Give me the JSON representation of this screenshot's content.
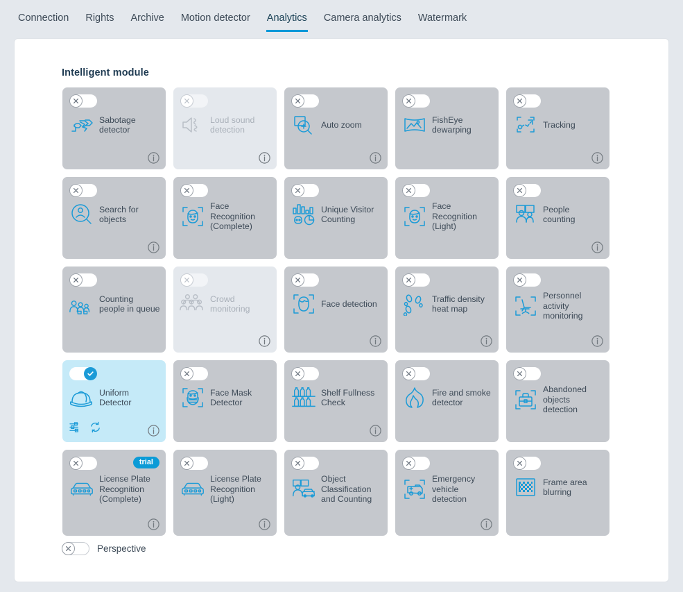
{
  "tabs": [
    {
      "label": "Connection",
      "active": false
    },
    {
      "label": "Rights",
      "active": false
    },
    {
      "label": "Archive",
      "active": false
    },
    {
      "label": "Motion detector",
      "active": false
    },
    {
      "label": "Analytics",
      "active": true
    },
    {
      "label": "Camera analytics",
      "active": false
    },
    {
      "label": "Watermark",
      "active": false
    }
  ],
  "panel": {
    "title": "Intelligent module"
  },
  "colors": {
    "page_background": "#e4e8ed",
    "panel_background": "#ffffff",
    "card_background": "#c5c8cd",
    "card_disabled_background": "#e4e8ed",
    "card_active_background": "#c5eaf8",
    "accent": "#0098d8",
    "toggle_on": "#1b9bd7",
    "trial_badge": "#0b9bd7",
    "text": "#3d4a57",
    "text_disabled": "#a9b0b9"
  },
  "modules": [
    {
      "label": "Sabotage detector",
      "icon": "sabotage-detector-icon",
      "toggle": "off",
      "state": "normal",
      "info": true,
      "badge": null,
      "actions": []
    },
    {
      "label": "Loud sound detection",
      "icon": "loud-sound-detection-icon",
      "toggle": "off",
      "state": "disabled",
      "info": true,
      "badge": null,
      "actions": []
    },
    {
      "label": "Auto zoom",
      "icon": "auto-zoom-icon",
      "toggle": "off",
      "state": "normal",
      "info": true,
      "badge": null,
      "actions": []
    },
    {
      "label": "FishEye dewarping",
      "icon": "fisheye-dewarping-icon",
      "toggle": "off",
      "state": "normal",
      "info": false,
      "badge": null,
      "actions": []
    },
    {
      "label": "Tracking",
      "icon": "tracking-icon",
      "toggle": "off",
      "state": "normal",
      "info": true,
      "badge": null,
      "actions": []
    },
    {
      "label": "Search for objects",
      "icon": "search-for-objects-icon",
      "toggle": "off",
      "state": "normal",
      "info": true,
      "badge": null,
      "actions": []
    },
    {
      "label": "Face Recognition (Complete)",
      "icon": "face-recognition-complete-icon",
      "toggle": "off",
      "state": "normal",
      "info": false,
      "badge": null,
      "actions": []
    },
    {
      "label": "Unique Visitor Counting",
      "icon": "unique-visitor-counting-icon",
      "toggle": "off",
      "state": "normal",
      "info": false,
      "badge": null,
      "actions": []
    },
    {
      "label": "Face Recognition (Light)",
      "icon": "face-recognition-light-icon",
      "toggle": "off",
      "state": "normal",
      "info": false,
      "badge": null,
      "actions": []
    },
    {
      "label": "People counting",
      "icon": "people-counting-icon",
      "toggle": "off",
      "state": "normal",
      "info": true,
      "badge": null,
      "actions": []
    },
    {
      "label": "Counting people in queue",
      "icon": "counting-people-in-queue-icon",
      "toggle": "off",
      "state": "normal",
      "info": false,
      "badge": null,
      "actions": []
    },
    {
      "label": "Crowd monitoring",
      "icon": "crowd-monitoring-icon",
      "toggle": "off",
      "state": "disabled",
      "info": true,
      "badge": null,
      "actions": []
    },
    {
      "label": "Face detection",
      "icon": "face-detection-icon",
      "toggle": "off",
      "state": "normal",
      "info": true,
      "badge": null,
      "actions": []
    },
    {
      "label": "Traffic density heat map",
      "icon": "traffic-density-heat-map-icon",
      "toggle": "off",
      "state": "normal",
      "info": true,
      "badge": null,
      "actions": []
    },
    {
      "label": "Personnel activity monitoring",
      "icon": "personnel-activity-monitoring-icon",
      "toggle": "off",
      "state": "normal",
      "info": true,
      "badge": null,
      "actions": []
    },
    {
      "label": "Uniform Detector",
      "icon": "uniform-detector-icon",
      "toggle": "on",
      "state": "active",
      "info": true,
      "badge": null,
      "actions": [
        "settings-icon",
        "refresh-icon"
      ]
    },
    {
      "label": "Face Mask Detector",
      "icon": "face-mask-detector-icon",
      "toggle": "off",
      "state": "normal",
      "info": false,
      "badge": null,
      "actions": []
    },
    {
      "label": "Shelf Fullness Check",
      "icon": "shelf-fullness-check-icon",
      "toggle": "off",
      "state": "normal",
      "info": true,
      "badge": null,
      "actions": []
    },
    {
      "label": "Fire and smoke detector",
      "icon": "fire-and-smoke-detector-icon",
      "toggle": "off",
      "state": "normal",
      "info": false,
      "badge": null,
      "actions": []
    },
    {
      "label": "Abandoned objects detection",
      "icon": "abandoned-objects-detection-icon",
      "toggle": "off",
      "state": "normal",
      "info": false,
      "badge": null,
      "actions": []
    },
    {
      "label": "License Plate Recognition (Complete)",
      "icon": "license-plate-recognition-icon",
      "toggle": "off",
      "state": "normal",
      "info": true,
      "badge": "trial",
      "actions": []
    },
    {
      "label": "License Plate Recognition (Light)",
      "icon": "license-plate-recognition-icon",
      "toggle": "off",
      "state": "normal",
      "info": true,
      "badge": null,
      "actions": []
    },
    {
      "label": "Object Classification and Counting",
      "icon": "object-classification-and-counting-icon",
      "toggle": "off",
      "state": "normal",
      "info": false,
      "badge": null,
      "actions": []
    },
    {
      "label": "Emergency vehicle detection",
      "icon": "emergency-vehicle-detection-icon",
      "toggle": "off",
      "state": "normal",
      "info": true,
      "badge": null,
      "actions": []
    },
    {
      "label": "Frame area blurring",
      "icon": "frame-area-blurring-icon",
      "toggle": "off",
      "state": "normal",
      "info": false,
      "badge": null,
      "actions": []
    }
  ],
  "perspective": {
    "label": "Perspective",
    "toggle": "off"
  }
}
